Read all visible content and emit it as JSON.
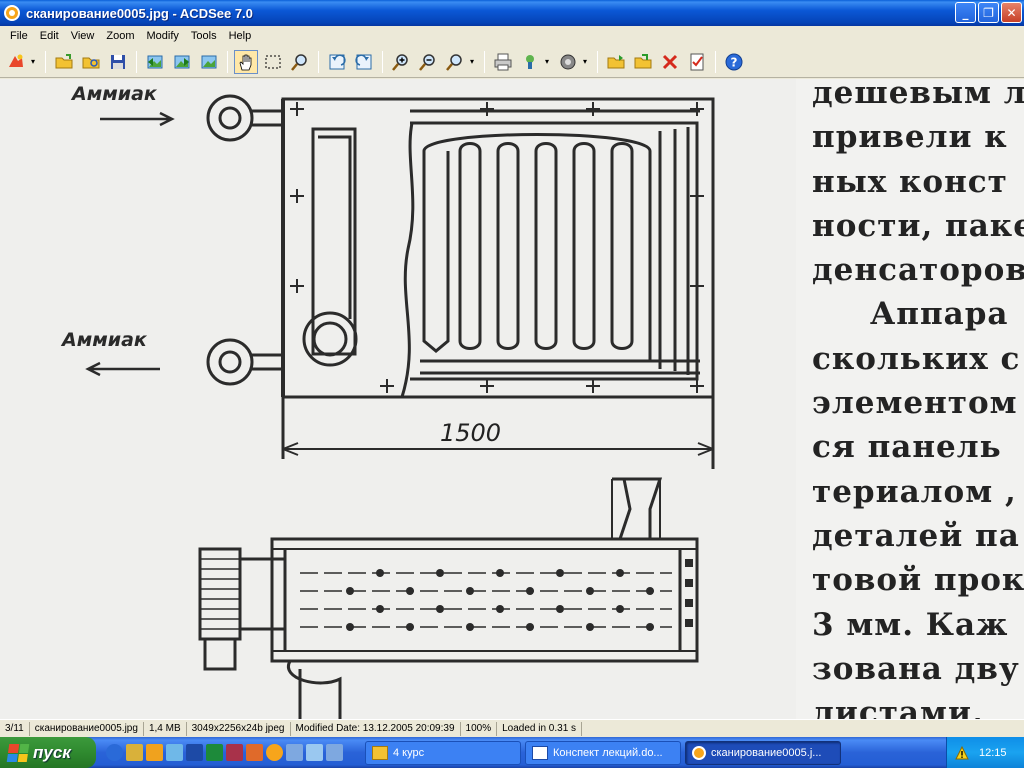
{
  "window": {
    "title": "сканирование0005.jpg - ACDSee 7.0",
    "controls": {
      "minimize": "_",
      "maximize": "❐",
      "close": "✕"
    }
  },
  "menu": [
    "File",
    "Edit",
    "View",
    "Zoom",
    "Modify",
    "Tools",
    "Help"
  ],
  "toolbar": {
    "icons": [
      "acquire-icon",
      "open-folder-icon",
      "browse-icon",
      "save-icon",
      "previous-image-icon",
      "next-image-icon",
      "fullscreen-icon",
      "hand-tool-icon",
      "select-tool-icon",
      "zoom-tool-icon",
      "rotate-left-icon",
      "rotate-right-icon",
      "zoom-in-icon",
      "zoom-out-icon",
      "zoom-menu-icon",
      "print-icon",
      "wallpaper-icon",
      "slideshow-icon",
      "copy-to-folder-icon",
      "move-to-folder-icon",
      "delete-icon",
      "properties-icon",
      "help-icon"
    ],
    "active_tool": "hand-tool-icon"
  },
  "image": {
    "text_lines": [
      "дешевым л",
      "привели к",
      "ных конст",
      "ности, паке",
      "денсаторов",
      "Аппара",
      "скольких с",
      "элементом",
      "ся панель",
      "териалом ,",
      "деталей па",
      "товой прок",
      "3 мм. Каж",
      "зована дву",
      "листами,"
    ],
    "labels": {
      "inlet": "Аммиак",
      "outlet": "Аммиак",
      "dimension": "1500"
    },
    "side_cap": "▴"
  },
  "status": {
    "index": "3/11",
    "filename": "сканирование0005.jpg",
    "filesize": "1,4 MB",
    "dimensions": "3049x2256x24b jpeg",
    "modified": "Modified Date: 13.12.2005 20:09:39",
    "zoom": "100%",
    "loaded": "Loaded in 0.31 s"
  },
  "taskbar": {
    "start_label": "пуск",
    "quick_launch": [
      "ie-icon",
      "winamp-icon",
      "outlook-icon",
      "net-icon",
      "word-icon",
      "excel-icon",
      "access-icon",
      "paint-icon",
      "acdsee-icon",
      "user-icon",
      "network-icon",
      "user2-icon"
    ],
    "tasks": [
      {
        "label": "4 курс",
        "state": "inactive",
        "icon": "folder-icon"
      },
      {
        "label": "Конспект лекций.do...",
        "state": "inactive",
        "icon": "word-doc-icon"
      },
      {
        "label": "сканирование0005.j...",
        "state": "active",
        "icon": "acdsee-app-icon"
      }
    ],
    "clock": "12:15",
    "colors": {
      "taskbar": "#245ed4",
      "start": "#2f8a2f",
      "tray": "#1aa3f0"
    }
  }
}
